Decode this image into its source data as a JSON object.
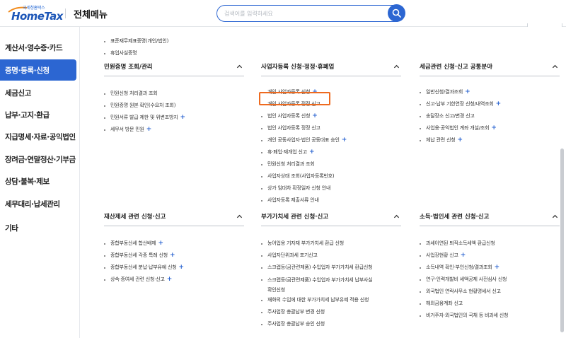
{
  "header": {
    "logo_small": "국세청홈택스",
    "logo_main": "HomeTax",
    "title": "전체메뉴",
    "search_placeholder": "검색어를 입력하세요"
  },
  "sidebar": {
    "items": [
      {
        "label": "계산서·영수증·카드",
        "active": false
      },
      {
        "label": "증명·등록·신청",
        "active": true
      },
      {
        "label": "세금신고",
        "active": false
      },
      {
        "label": "납부·고지·환급",
        "active": false
      },
      {
        "label": "지급명세·자료·공익법인",
        "active": false
      },
      {
        "label": "장려금·연말정산·기부금",
        "active": false
      },
      {
        "label": "상담·불복·제보",
        "active": false
      },
      {
        "label": "세무대리·납세관리",
        "active": false
      },
      {
        "label": "기타",
        "active": false
      }
    ]
  },
  "top_list": [
    {
      "label": "표준재무제표증명(개인/법인)",
      "plus": false
    },
    {
      "label": "휴업사실증명",
      "plus": false
    }
  ],
  "sections": [
    {
      "title": "민원증명 조회/관리",
      "items": [
        {
          "label": "민원신청 처리결과 조회",
          "plus": false
        },
        {
          "label": "민원증명 원본 확인(수요처 조회)",
          "plus": false
        },
        {
          "label": "민원서류 발급 제한 및 위변조방지",
          "plus": true
        },
        {
          "label": "세무서 방문 민원",
          "plus": true
        }
      ]
    },
    {
      "title": "사업자등록 신청·정정·휴폐업",
      "items": [
        {
          "label": "개인 사업자등록 신청",
          "plus": true
        },
        {
          "label": "개인 사업자등록 정정 신고",
          "plus": false
        },
        {
          "label": "법인 사업자등록 신청",
          "plus": true
        },
        {
          "label": "법인 사업자등록 정정 신고",
          "plus": false
        },
        {
          "label": "개인 공동사업자·법인 공동대표 승인",
          "plus": true
        },
        {
          "label": "휴·폐업·재개업 신고",
          "plus": true
        },
        {
          "label": "민원신청 처리결과 조회",
          "plus": false
        },
        {
          "label": "사업자상태 조회(사업자등록번호)",
          "plus": false
        },
        {
          "label": "상가 임대차 확정일자 신청 안내",
          "plus": false
        },
        {
          "label": "사업자등록 제출서류 안내",
          "plus": false
        }
      ]
    },
    {
      "title": "세금관련 신청·신고 공통분야",
      "items": [
        {
          "label": "일반신청/결과조회",
          "plus": true
        },
        {
          "label": "신고·납부 기한연장 신청/내역조회",
          "plus": true
        },
        {
          "label": "송달장소 신고/변경 신고",
          "plus": false
        },
        {
          "label": "사업용·공익법인 계좌 개설/조회",
          "plus": true
        },
        {
          "label": "체납 관련 신청",
          "plus": true
        }
      ]
    },
    {
      "title": "재산제세 관련 신청·신고",
      "items": [
        {
          "label": "종합부동산세 합산배제",
          "plus": true
        },
        {
          "label": "종합부동산세 각종 특례 신청",
          "plus": true
        },
        {
          "label": "종합부동산세 분납·납부유예 신청",
          "plus": true
        },
        {
          "label": "상속·증여세 관련 신청·신고",
          "plus": true
        }
      ]
    },
    {
      "title": "부가가치세 관련 신청·신고",
      "items": [
        {
          "label": "농어업용 기자재 부가가치세 환급 신청",
          "plus": false
        },
        {
          "label": "사업자단위과세 포기신고",
          "plus": false
        },
        {
          "label": "스크랩등(금관련제품) 수입업자 부가가치세 환급신청",
          "plus": false
        },
        {
          "label": "스크랩등(금관련제품) 수입업자 부가가치세 납부사실",
          "cont": "확인신청",
          "plus": false
        },
        {
          "label": "재화의 수입에 대한 부가가치세 납부유예 적용 신청",
          "plus": false
        },
        {
          "label": "주사업장 총괄납부 변경 신청",
          "plus": false
        },
        {
          "label": "주사업장 총괄납부 승인 신청",
          "plus": false
        }
      ]
    },
    {
      "title": "소득·법인세 관련 신청·신고",
      "items": [
        {
          "label": "과세이연된 퇴직소득세액 환급신청",
          "plus": false
        },
        {
          "label": "사업장현황 신고",
          "plus": true
        },
        {
          "label": "소득내역 확인·부인신청/결과조회",
          "plus": true
        },
        {
          "label": "연구·인력개발비 세액공제 사전심사 신청",
          "plus": false
        },
        {
          "label": "외국법인 연락사무소 현황명세서 신고",
          "plus": false
        },
        {
          "label": "해외금융계좌 신고",
          "plus": false
        },
        {
          "label": "비거주자·외국법인의 국채 등 비과세 신청",
          "plus": false
        }
      ]
    }
  ],
  "plus_symbol": "+",
  "colors": {
    "accent": "#2c66d2",
    "highlight": "#ee6a1f"
  }
}
